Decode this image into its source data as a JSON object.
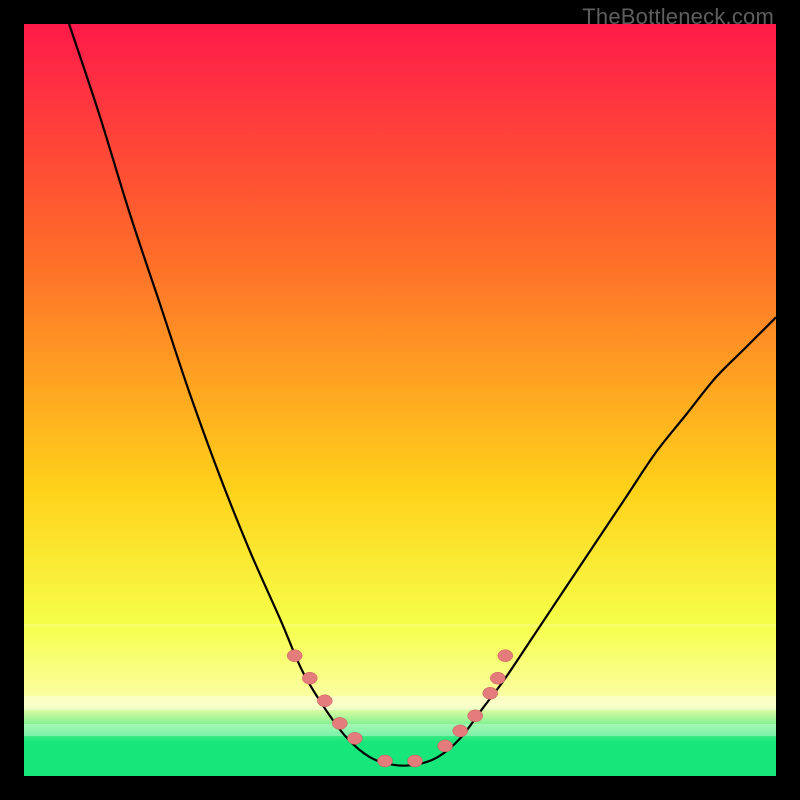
{
  "watermark": "TheBottleneck.com",
  "colors": {
    "frame": "#000000",
    "grad_top": "#ff1a4a",
    "grad_mid1": "#ff6a2a",
    "grad_mid2": "#ffd21a",
    "grad_lowyellow": "#f6ff4a",
    "grad_paleyellow": "#fbffab",
    "grad_green": "#17e67a",
    "curve": "#000000",
    "marker_fill": "#e57c7c",
    "marker_stroke": "#c55a5a"
  },
  "chart_data": {
    "type": "line",
    "title": "",
    "xlabel": "",
    "ylabel": "",
    "xlim": [
      0,
      100
    ],
    "ylim": [
      0,
      100
    ],
    "series": [
      {
        "name": "bottleneck-curve",
        "x": [
          6,
          10,
          14,
          18,
          22,
          26,
          30,
          34,
          37,
          40,
          43,
          46,
          49,
          52,
          55,
          58,
          61,
          64,
          68,
          72,
          76,
          80,
          84,
          88,
          92,
          96,
          100
        ],
        "y": [
          100,
          88,
          75,
          63,
          51,
          40,
          30,
          21,
          14,
          9,
          5,
          2.5,
          1.5,
          1.5,
          2.5,
          5,
          9,
          13,
          19,
          25,
          31,
          37,
          43,
          48,
          53,
          57,
          61
        ]
      }
    ],
    "markers": {
      "comment": "approximate positions of salmon-colored points along the curve near the trough",
      "x": [
        36,
        38,
        40,
        42,
        44,
        48,
        52,
        56,
        58,
        60,
        62,
        63,
        64
      ],
      "y": [
        16,
        13,
        10,
        7,
        5,
        2,
        2,
        4,
        6,
        8,
        11,
        13,
        16
      ]
    }
  }
}
